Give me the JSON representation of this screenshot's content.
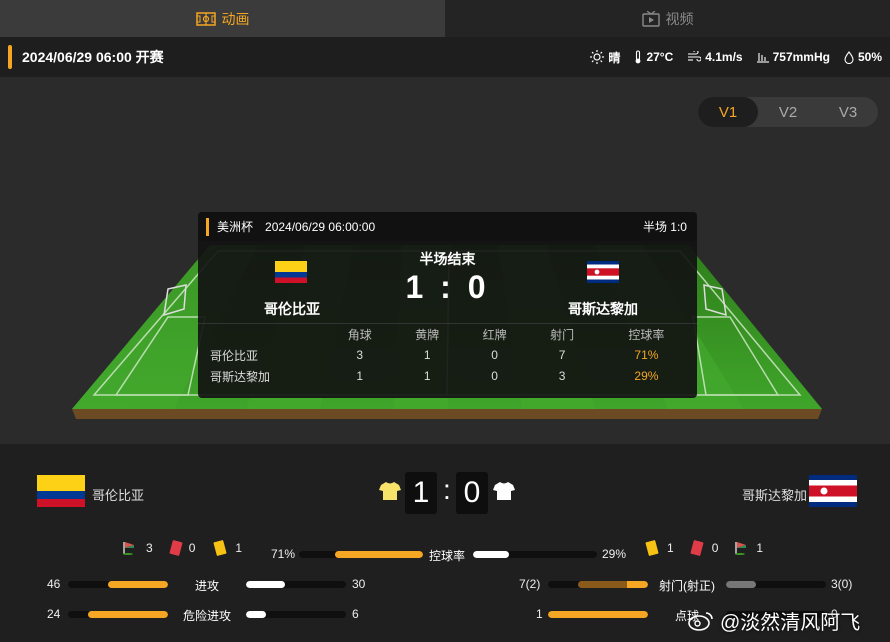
{
  "tabs": [
    {
      "label": "动画",
      "icon": "pitch-icon"
    },
    {
      "label": "视频",
      "icon": "tv-icon"
    }
  ],
  "info": {
    "datetime": "2024/06/29 06:00 开赛",
    "weather": "晴",
    "temperature": "27°C",
    "wind": "4.1m/s",
    "pressure": "757mmHg",
    "humidity": "50%"
  },
  "view_switch": [
    "V1",
    "V2",
    "V3"
  ],
  "card": {
    "competition": "美洲杯",
    "time": "2024/06/29 06:00:00",
    "halftime": "半场 1:0",
    "status": "半场结束",
    "score": "1 : 0",
    "home": "哥伦比亚",
    "away": "哥斯达黎加",
    "columns": [
      "角球",
      "黄牌",
      "红牌",
      "射门",
      "控球率"
    ],
    "rows": [
      {
        "team": "哥伦比亚",
        "values": [
          "3",
          "1",
          "0",
          "7",
          "71%"
        ]
      },
      {
        "team": "哥斯达黎加",
        "values": [
          "1",
          "1",
          "0",
          "3",
          "29%"
        ]
      }
    ]
  },
  "scoreboard": {
    "home": "哥伦比亚",
    "away": "哥斯达黎加",
    "home_digit": "1",
    "away_digit": "0",
    "colon": ":"
  },
  "counts": {
    "home": {
      "corners": "3",
      "red": "0",
      "yellow": "1"
    },
    "away": {
      "yellow": "1",
      "red": "0",
      "corners": "1"
    }
  },
  "stats": {
    "possession": {
      "label": "控球率",
      "home": "71%",
      "away": "29%",
      "home_frac": 0.71,
      "away_frac": 0.29
    },
    "attack": {
      "label": "进攻",
      "home": "46",
      "away": "30",
      "home_frac": 0.6,
      "away_frac": 0.39
    },
    "dangerous": {
      "label": "危险进攻",
      "home": "24",
      "away": "6",
      "home_frac": 0.8,
      "away_frac": 0.2
    },
    "shots": {
      "label": "射门(射正)",
      "home": "7(2)",
      "away": "3(0)",
      "home_frac": 0.7,
      "away_frac": 0.3
    },
    "penalty": {
      "label": "点球",
      "home": "1",
      "away": "0",
      "home_frac": 1.0,
      "away_frac": 0.0
    }
  },
  "colors": {
    "accent": "#f5a623",
    "pitch": "#3a9a22",
    "home_shirt": "#f7e36a",
    "away_shirt": "#ffffff"
  },
  "watermark": "@淡然清风阿飞"
}
